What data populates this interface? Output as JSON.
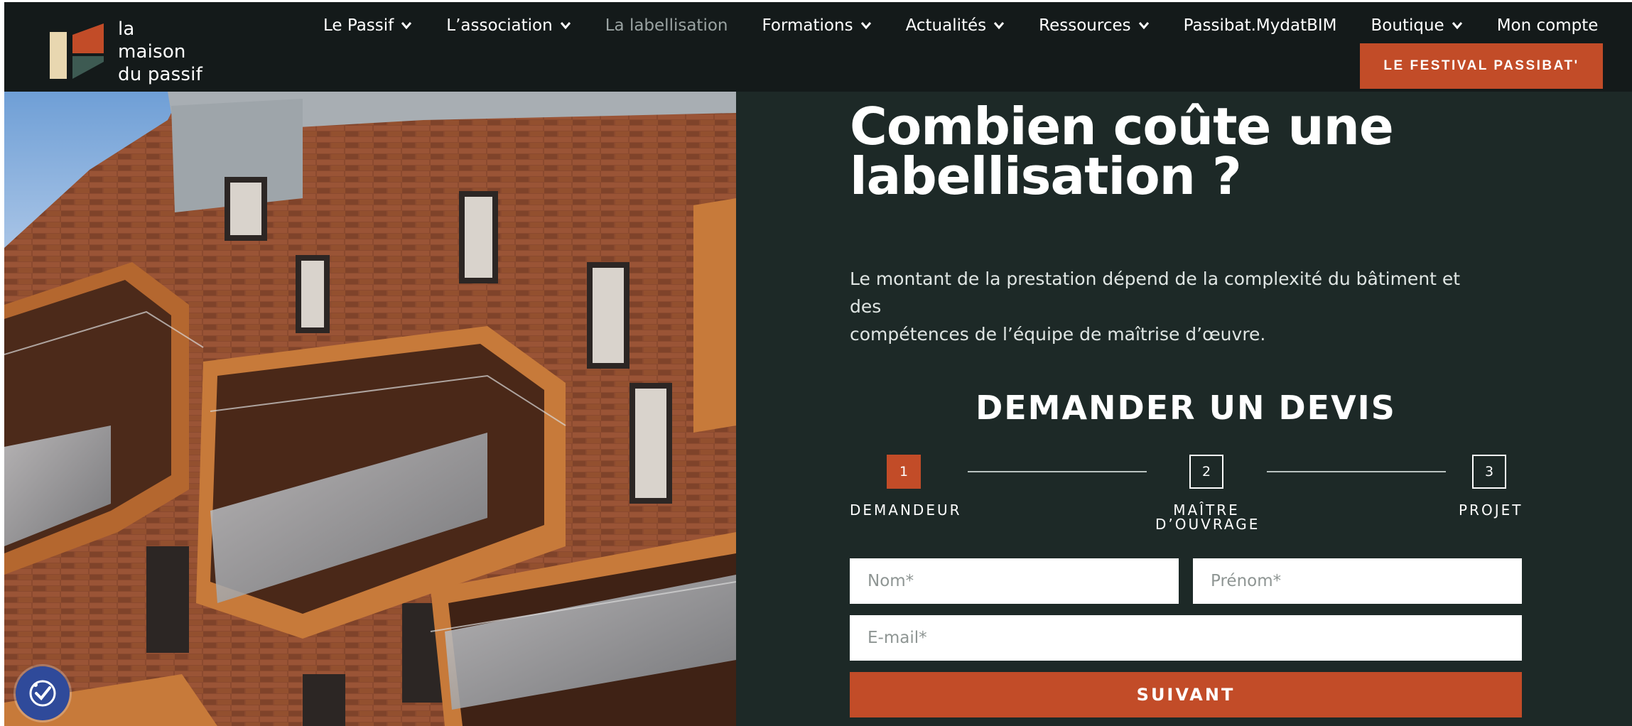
{
  "brand": {
    "logo_lines": [
      "la",
      "maison",
      "du passif"
    ],
    "colors": {
      "accent": "#c24c28",
      "header_bg": "#141a1a",
      "panel_bg": "#1d2927"
    }
  },
  "nav": {
    "items": [
      {
        "label": "Le Passif",
        "has_dropdown": true
      },
      {
        "label": "L’association",
        "has_dropdown": true
      },
      {
        "label": "La labellisation",
        "has_dropdown": false,
        "current": true
      },
      {
        "label": "Formations",
        "has_dropdown": true
      },
      {
        "label": "Actualités",
        "has_dropdown": true
      },
      {
        "label": "Ressources",
        "has_dropdown": true
      },
      {
        "label": "Passibat.MydatBIM",
        "has_dropdown": false
      },
      {
        "label": "Boutique",
        "has_dropdown": true
      },
      {
        "label": "Mon compte",
        "has_dropdown": false
      }
    ],
    "cta_label": "LE FESTIVAL PASSIBAT'"
  },
  "main": {
    "headline_lines": [
      "Combien coûte une",
      "labellisation ?"
    ],
    "intro_lines": [
      "Le montant de la prestation dépend de la complexité du bâtiment et des",
      "compétences de l’équipe de maîtrise d’œuvre."
    ]
  },
  "form": {
    "title": "DEMANDER UN DEVIS",
    "steps": [
      {
        "number": "1",
        "label_lines": [
          "DEMANDEUR"
        ],
        "active": true
      },
      {
        "number": "2",
        "label_lines": [
          "MAÎTRE",
          "D’OUVRAGE"
        ],
        "active": false
      },
      {
        "number": "3",
        "label_lines": [
          "PROJET"
        ],
        "active": false
      }
    ],
    "fields": {
      "nom_placeholder": "Nom*",
      "prenom_placeholder": "Prénom*",
      "email_placeholder": "E-mail*"
    },
    "submit_label": "SUIVANT"
  },
  "icons": {
    "nav_dropdown": "chevron-down-icon",
    "accessibility": "accessibility-check-icon"
  }
}
